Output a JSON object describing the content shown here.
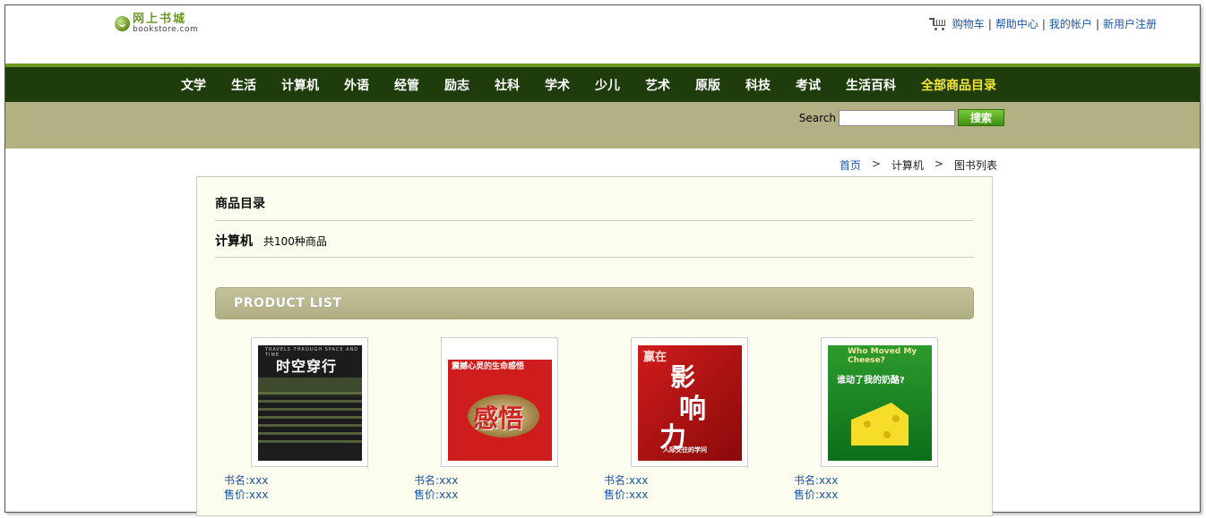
{
  "header": {
    "logo_cn": "网上书城",
    "logo_en": "bookstore.com",
    "links": [
      "购物车",
      "帮助中心",
      "我的帐户",
      "新用户注册"
    ]
  },
  "nav": {
    "items": [
      "文学",
      "生活",
      "计算机",
      "外语",
      "经管",
      "励志",
      "社科",
      "学术",
      "少儿",
      "艺术",
      "原版",
      "科技",
      "考试",
      "生活百科"
    ],
    "all_label": "全部商品目录"
  },
  "search": {
    "label": "Search",
    "value": "",
    "button": "搜索"
  },
  "breadcrumb": {
    "home": "首页",
    "sep": ">",
    "category": "计算机",
    "current": "图书列表"
  },
  "catalog": {
    "title": "商品目录",
    "category": "计算机",
    "count_text": "共100种商品",
    "product_list_label": "PRODUCT LIST"
  },
  "products": [
    {
      "name_text": "书名:xxx",
      "price_text": "售价:xxx",
      "cover_title": "时空穿行",
      "cover_small": "TRAVELS THROUGH SPACE AND TIME"
    },
    {
      "name_text": "书名:xxx",
      "price_text": "售价:xxx",
      "cover_title": "感悟",
      "cover_small": "震撼心灵的生命感悟"
    },
    {
      "name_text": "书名:xxx",
      "price_text": "售价:xxx",
      "cover_title_a": "赢在",
      "cover_title_b": "影",
      "cover_title_c": "响",
      "cover_title_d": "力",
      "cover_small": "人际交往的学问"
    },
    {
      "name_text": "书名:xxx",
      "price_text": "售价:xxx",
      "cover_small": "Who Moved My Cheese?",
      "cover_title": "谁动了我的奶酪?"
    }
  ],
  "colors": {
    "nav_bg": "#1f3d0c",
    "nav_accent": "#6b9a25",
    "nav_highlight": "#f4e53a",
    "strip_bg": "#b3b184",
    "link": "#1a56a8",
    "content_bg": "#fcfcef"
  }
}
